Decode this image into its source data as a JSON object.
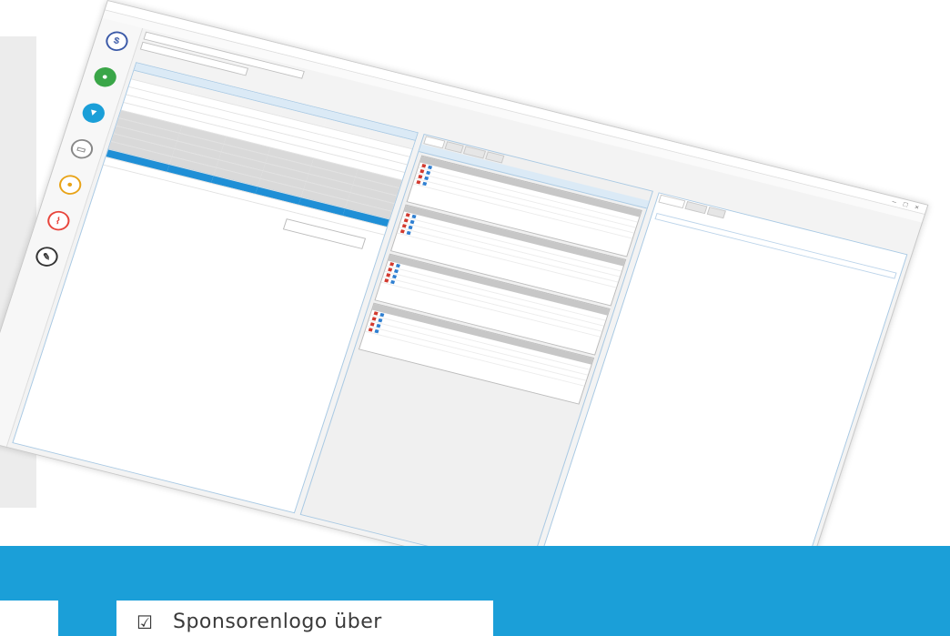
{
  "checkbox_item": {
    "icon": "ballot-box-with-check-icon",
    "glyph": "☑",
    "label": "Sponsorenlogo über"
  },
  "colors": {
    "band": "#1b9fd8",
    "selected_row": "#1f8fd6",
    "panel_border": "#a9c9e3"
  }
}
